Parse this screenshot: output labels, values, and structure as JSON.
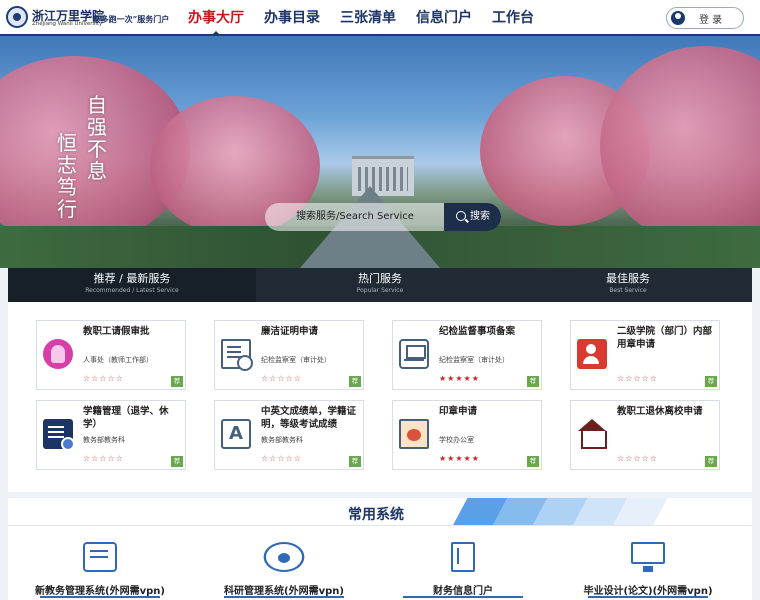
{
  "header": {
    "logo_name": "浙江万里学院",
    "logo_en": "Zhejiang Wanli University",
    "logo_slogan": "“最多跑一次”服务门户",
    "nav": [
      {
        "label": "办事大厅",
        "active": true
      },
      {
        "label": "办事目录",
        "active": false
      },
      {
        "label": "三张清单",
        "active": false
      },
      {
        "label": "信息门户",
        "active": false
      },
      {
        "label": "工作台",
        "active": false
      }
    ],
    "login_label": "登 录"
  },
  "hero": {
    "calligraphy_1": "自强不息",
    "calligraphy_2": "恒志笃行",
    "search_placeholder": "搜索服务/Search Service",
    "search_button": "搜索"
  },
  "tabs": [
    {
      "cn": "推荐 / 最新服务",
      "en": "Recommended / Latest Service",
      "active": true
    },
    {
      "cn": "热门服务",
      "en": "Popular Service",
      "active": false
    },
    {
      "cn": "最佳服务",
      "en": "Best Service",
      "active": false
    }
  ],
  "services": [
    {
      "title": "教职工请假审批",
      "dept": "人事处（教师工作部）",
      "rating": 0,
      "icon": "user-pink-icon",
      "tag": "荐"
    },
    {
      "title": "廉洁证明申请",
      "dept": "纪检监察室（审计处）",
      "rating": 0,
      "icon": "certificate-icon",
      "tag": "荐"
    },
    {
      "title": "纪检监督事项备案",
      "dept": "纪检监察室（审计处）",
      "rating": 5,
      "icon": "filing-icon",
      "tag": "荐"
    },
    {
      "title": "二级学院（部门）内部用章申请",
      "dept": "",
      "rating": 0,
      "icon": "seal-user-icon",
      "tag": "荐"
    },
    {
      "title": "学籍管理（退学、休学）",
      "dept": "教务部教务科",
      "rating": 0,
      "icon": "student-record-icon",
      "tag": "荐"
    },
    {
      "title": "中英文成绩单，学籍证明，等级考试成绩",
      "dept": "教务部教务科",
      "rating": 0,
      "icon": "grade-icon",
      "tag": "荐"
    },
    {
      "title": "印章申请",
      "dept": "学校办公室",
      "rating": 5,
      "icon": "stamp-icon",
      "tag": "荐"
    },
    {
      "title": "教职工退休离校申请",
      "dept": "",
      "rating": 0,
      "icon": "retirement-house-icon",
      "tag": "荐"
    }
  ],
  "common": {
    "title": "常用系统",
    "items": [
      {
        "label": "新教务管理系统(外网需vpn)",
        "icon": "academic-system-icon"
      },
      {
        "label": "科研管理系统(外网需vpn)",
        "icon": "research-atom-icon"
      },
      {
        "label": "财务信息门户",
        "icon": "finance-book-icon"
      },
      {
        "label": "毕业设计(论文)(外网需vpn)",
        "icon": "thesis-monitor-icon"
      }
    ]
  },
  "colors": {
    "navy": "#1d3566",
    "accent_red": "#c8161d",
    "tag_green": "#6aa84f",
    "link_blue": "#2e6ab8"
  }
}
